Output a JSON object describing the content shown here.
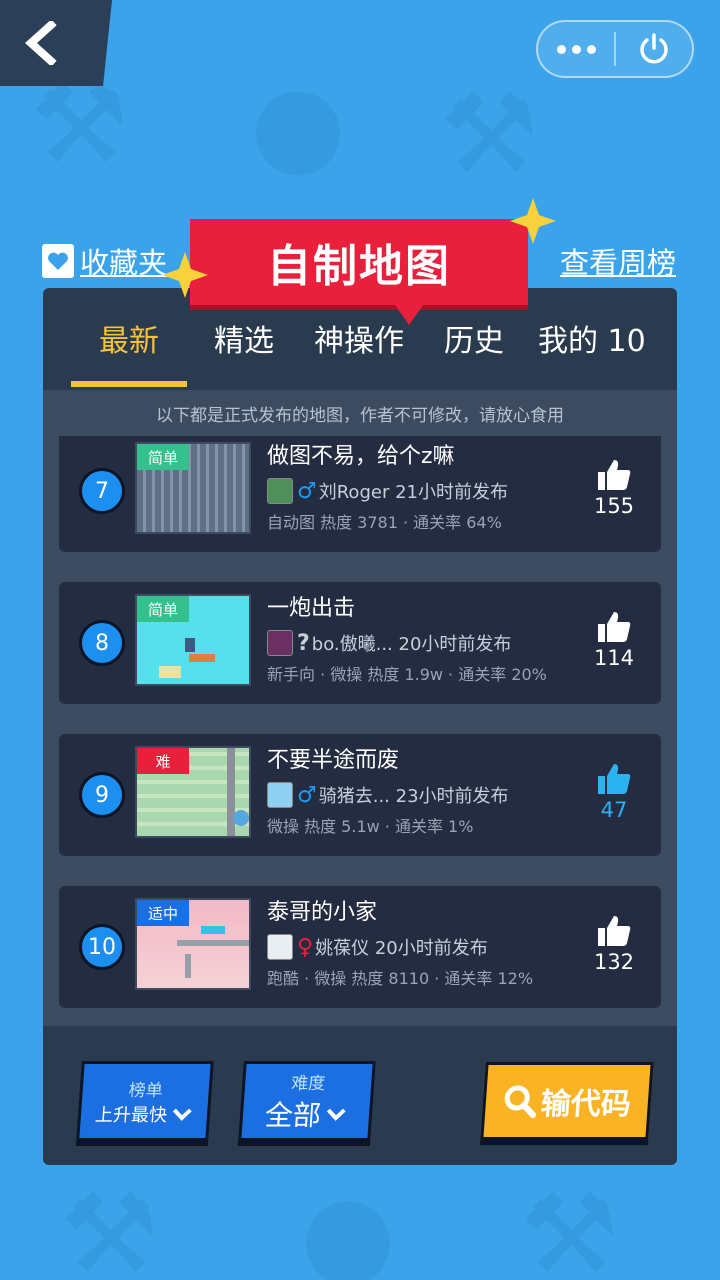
{
  "header": {
    "back_icon": "chevron-left-icon",
    "more_icon": "more-dots-icon",
    "power_icon": "power-icon"
  },
  "favorites_label": "收藏夹",
  "weekly_label": "查看周榜",
  "title": "自制地图",
  "tabs": [
    {
      "label": "最新",
      "active": true
    },
    {
      "label": "精选",
      "active": false
    },
    {
      "label": "神操作",
      "active": false
    },
    {
      "label": "历史",
      "active": false
    },
    {
      "label": "我的 10",
      "active": false
    }
  ],
  "notice": "以下都是正式发布的地图，作者不可修改，请放心食用",
  "maps": [
    {
      "rank": "7",
      "difficulty": "简单",
      "difficulty_color": "#35c08e",
      "thumb_color": "#6f7e95",
      "title": "做图不易，给个z嘛",
      "gender": "♂",
      "gender_color": "#1c9bf0",
      "author": "刘Roger 21小时前发布",
      "meta": "自动图 热度 3781 · 通关率 64%",
      "likes": "155",
      "liked": false
    },
    {
      "rank": "8",
      "difficulty": "简单",
      "difficulty_color": "#35c08e",
      "thumb_color": "#55e0ec",
      "title": "一炮出击",
      "gender": "?",
      "gender_color": "#c7cfda",
      "author": "bo.傲曦... 20小时前发布",
      "meta": "新手向 · 微操 热度 1.9w · 通关率 20%",
      "likes": "114",
      "liked": false
    },
    {
      "rank": "9",
      "difficulty": "难",
      "difficulty_color": "#e8203b",
      "thumb_color": "#a9d8b0",
      "title": "不要半途而废",
      "gender": "♂",
      "gender_color": "#1c9bf0",
      "author": "骑猪去... 23小时前发布",
      "meta": "微操 热度 5.1w · 通关率 1%",
      "likes": "47",
      "liked": true
    },
    {
      "rank": "10",
      "difficulty": "适中",
      "difficulty_color": "#1c6fe0",
      "thumb_color": "#f2b8c6",
      "title": "泰哥的小家",
      "gender": "♀",
      "gender_color": "#e8203b",
      "author": "姚葆仪 20小时前发布",
      "meta": "跑酷 · 微操 热度 8110 · 通关率 12%",
      "likes": "132",
      "liked": false
    }
  ],
  "footer": {
    "rank_label": "榜单",
    "rank_value": "上升最快",
    "difficulty_label": "难度",
    "difficulty_value": "全部",
    "code_label": "输代码"
  },
  "colors": {
    "accent": "#f5c33b",
    "title_red": "#e8203b",
    "panel": "#2a3a4f",
    "like_active": "#2bb2f0"
  }
}
